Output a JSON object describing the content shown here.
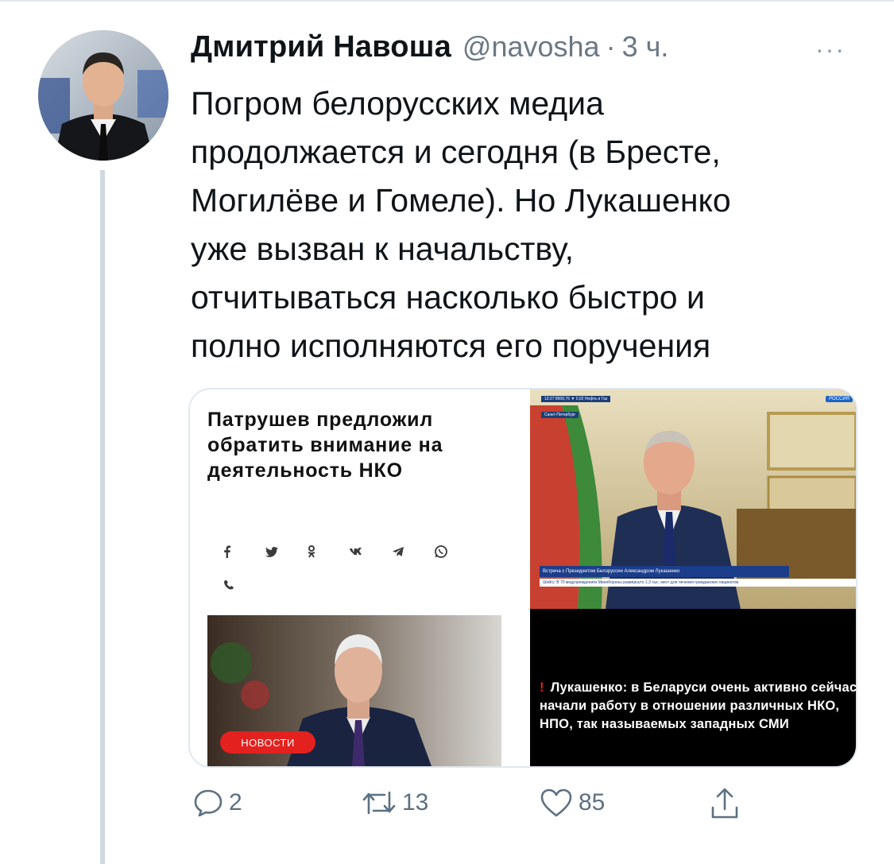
{
  "tweet": {
    "author_name": "Дмитрий Навоша",
    "handle": "@navosha",
    "separator": "·",
    "time": "3 ч.",
    "more": "···",
    "text": "Погром белорусских медиа\nпродолжается и сегодня (в Бресте,\nМогилёве и Гомеле). Но Лукашенко\nуже вызван к начальству,\nотчитываться насколько быстро и\nполно исполняются его поручения"
  },
  "media": {
    "left_card": {
      "headline": "Патрушев предложил обратить внимание на деятельность НКО",
      "share_icons": [
        "facebook-icon",
        "twitter-icon",
        "odnoklassniki-icon",
        "vk-icon",
        "telegram-icon",
        "whatsapp-icon",
        "viber-icon"
      ],
      "badge": "НОВОСТИ"
    },
    "right_card": {
      "ticker": "13:27  8909,76 ▼ 0,02  Нефть и Газ",
      "city": "Санкт-Петербург",
      "channel": "РОССИЯ",
      "caption": "Встреча с Президентом Белоруссии Александром Лукашенко",
      "crawl": "Шойгу: В 70 медучреждениях Минобороны развёрнуто 1,3 тыс. мест для лечения гражданских пациентов",
      "quote_mark": "!",
      "quote": "Лукашенко: в Беларуси очень активно сейчас начали работу в отношении различных НКО, НПО, так называемых западных СМИ"
    }
  },
  "actions": {
    "reply_count": "2",
    "retweet_count": "13",
    "like_count": "85"
  },
  "colors": {
    "text": "#0f1419",
    "secondary": "#5b7083",
    "border": "#e1e8ed",
    "badge_red": "#e3211e"
  }
}
